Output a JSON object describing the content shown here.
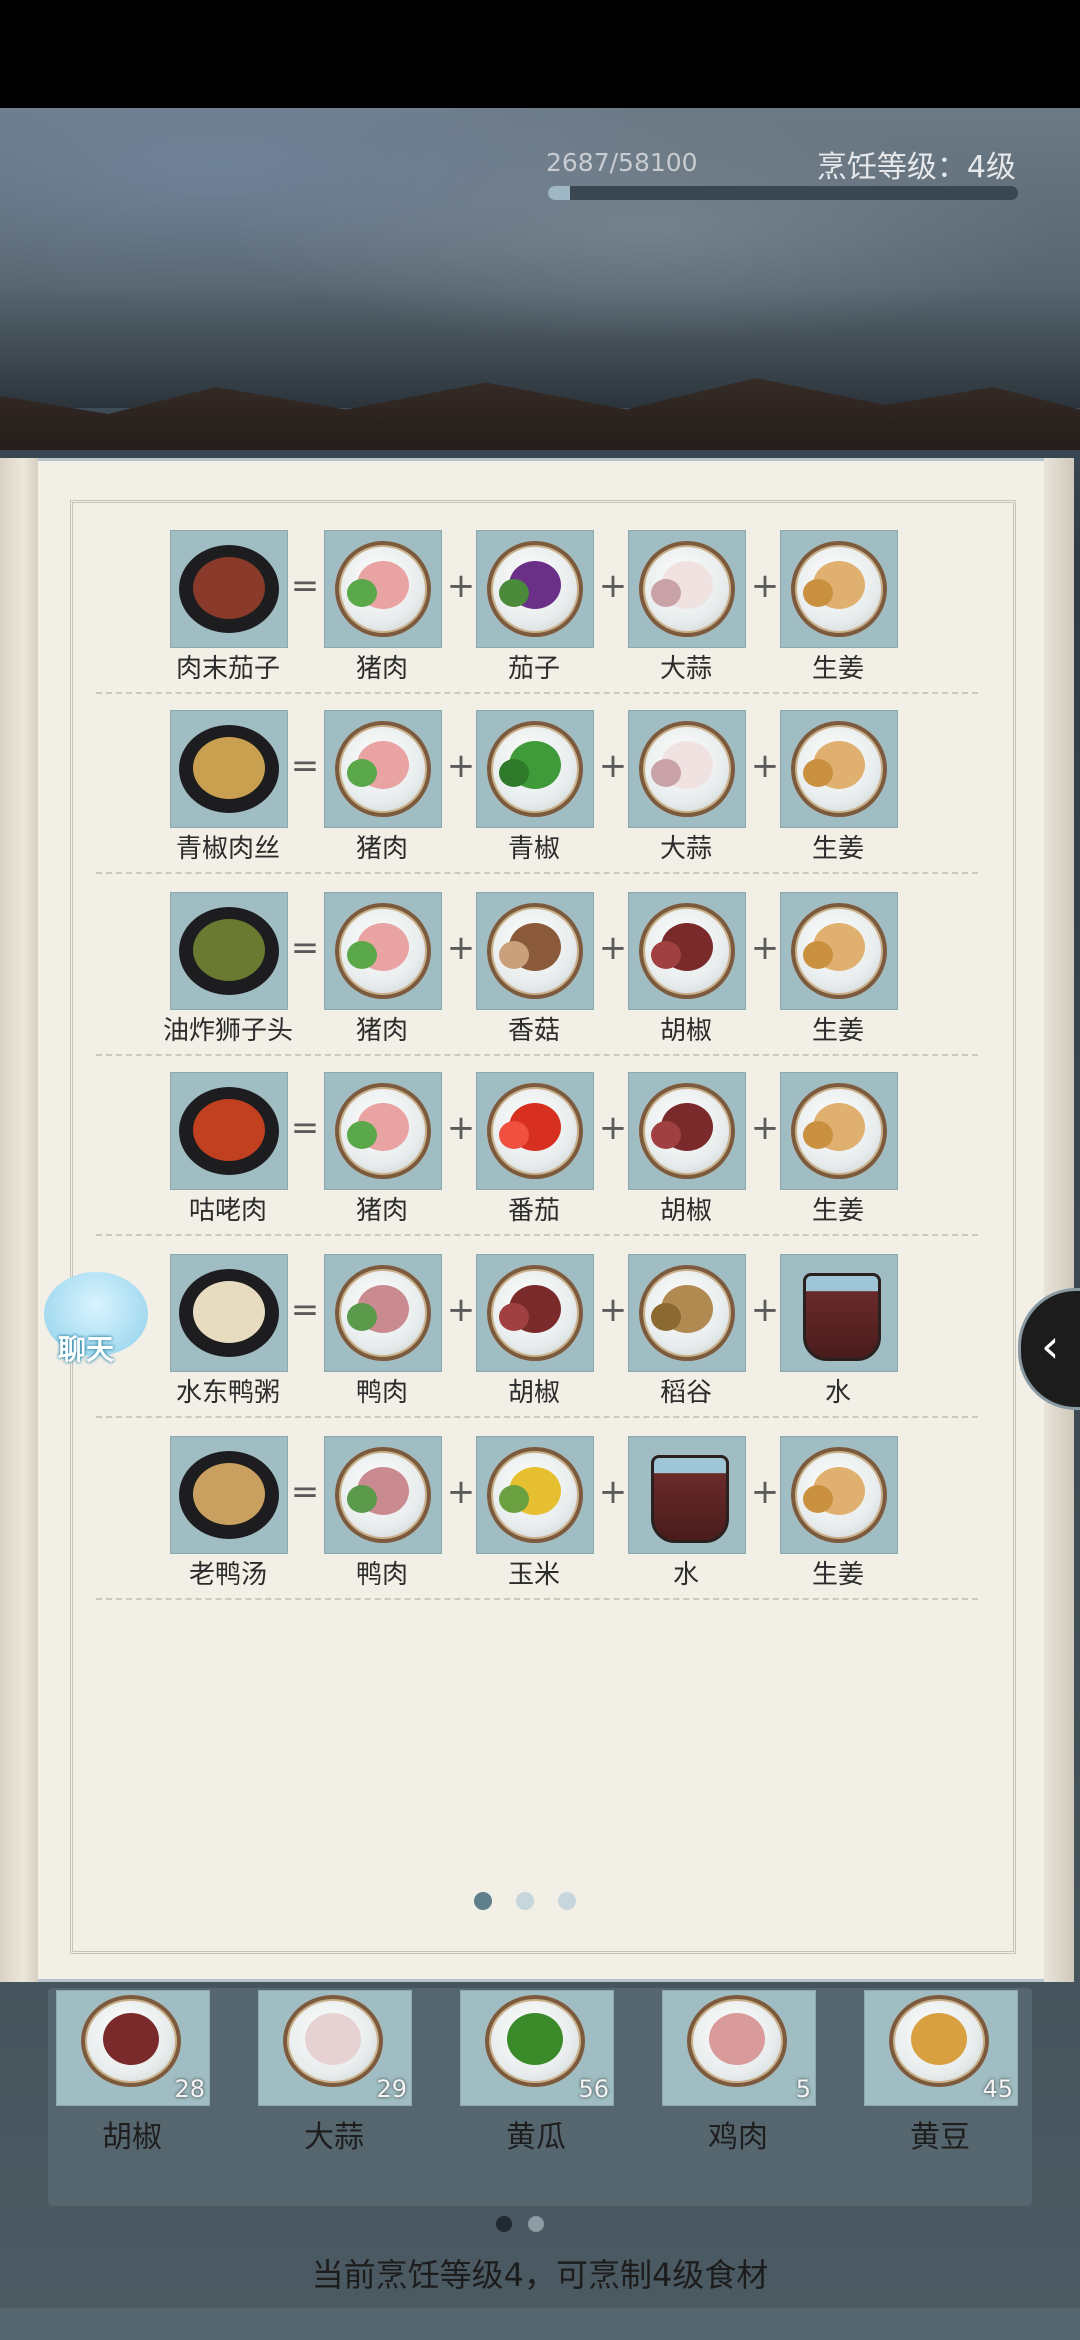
{
  "header": {
    "progress_text": "2687/58100",
    "progress_fraction": 0.046,
    "cook_level_text": "烹饪等级：4级"
  },
  "recipes": [
    {
      "dish": "肉末茄子",
      "ingredients": [
        "猪肉",
        "茄子",
        "大蒜",
        "生姜"
      ]
    },
    {
      "dish": "青椒肉丝",
      "ingredients": [
        "猪肉",
        "青椒",
        "大蒜",
        "生姜"
      ]
    },
    {
      "dish": "油炸狮子头",
      "ingredients": [
        "猪肉",
        "香菇",
        "胡椒",
        "生姜"
      ]
    },
    {
      "dish": "咕咾肉",
      "ingredients": [
        "猪肉",
        "番茄",
        "胡椒",
        "生姜"
      ]
    },
    {
      "dish": "水东鸭粥",
      "ingredients": [
        "鸭肉",
        "胡椒",
        "稻谷",
        "水"
      ]
    },
    {
      "dish": "老鸭汤",
      "ingredients": [
        "鸭肉",
        "玉米",
        "水",
        "生姜"
      ]
    }
  ],
  "operators": {
    "equals": "=",
    "plus": "+"
  },
  "chat": {
    "label": "聊天"
  },
  "side_tab": {
    "arrow": "‹"
  },
  "book_page_indicator": {
    "total": 3,
    "active": 0
  },
  "inventory": [
    {
      "name": "胡椒",
      "count": "28"
    },
    {
      "name": "大蒜",
      "count": "29"
    },
    {
      "name": "黄瓜",
      "count": "56"
    },
    {
      "name": "鸡肉",
      "count": "5"
    },
    {
      "name": "黄豆",
      "count": "45"
    }
  ],
  "inventory_page_indicator": {
    "total": 2,
    "active": 0
  },
  "status": {
    "text": "当前烹饪等级4，可烹制4级食材"
  },
  "colors": {
    "tile": "#9fbdc2",
    "book": "#f2efe6",
    "panel": "#56666f"
  }
}
